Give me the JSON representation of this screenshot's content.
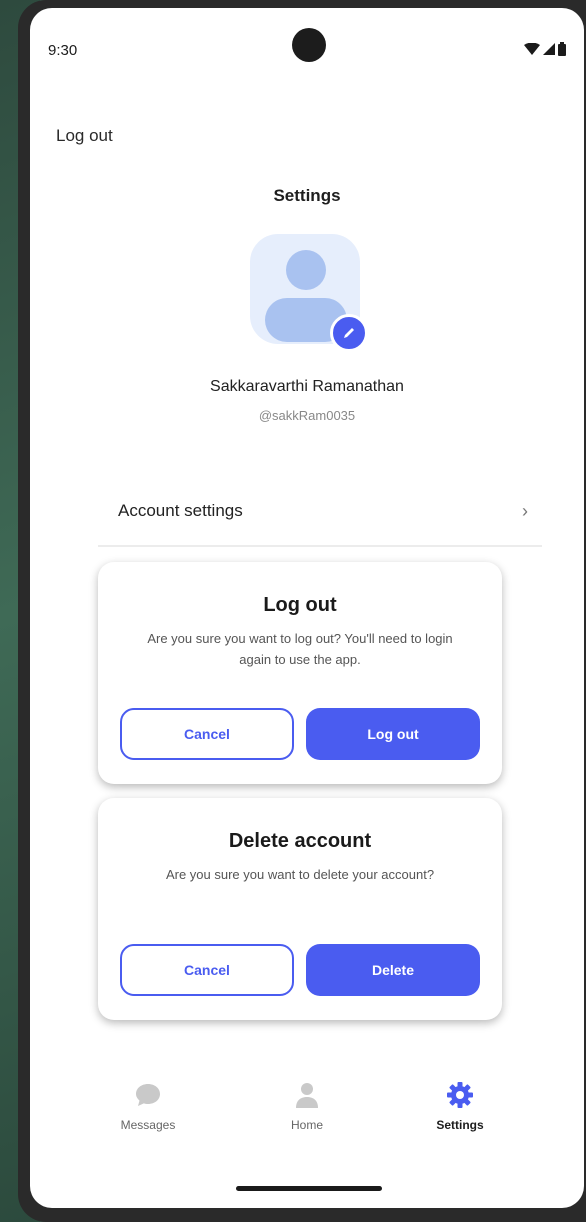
{
  "status_bar": {
    "time": "9:30"
  },
  "header": {
    "logout_link": "Log out",
    "title": "Settings"
  },
  "profile": {
    "name": "Sakkaravarthi Ramanathan",
    "handle": "@sakkRam0035"
  },
  "account_settings": {
    "label": "Account settings",
    "chevron": "›"
  },
  "logout_dialog": {
    "title": "Log out",
    "message": "Are you sure you want to log out? You'll need to login again to use the app.",
    "cancel_label": "Cancel",
    "confirm_label": "Log out"
  },
  "delete_dialog": {
    "title": "Delete account",
    "message": "Are you sure you want to delete your account?",
    "cancel_label": "Cancel",
    "confirm_label": "Delete"
  },
  "bottom_nav": {
    "items": [
      {
        "label": "Messages",
        "icon": "chat-icon",
        "active": false
      },
      {
        "label": "Home",
        "icon": "person-icon",
        "active": false
      },
      {
        "label": "Settings",
        "icon": "gear-icon",
        "active": true
      }
    ]
  },
  "colors": {
    "accent": "#4a5cf0",
    "avatar_bg": "#e6eefc",
    "avatar_fg": "#a9c2f0"
  }
}
